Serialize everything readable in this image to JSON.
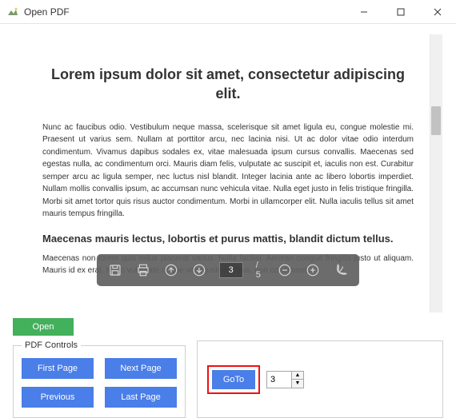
{
  "window": {
    "title": "Open PDF"
  },
  "document": {
    "heading": "Lorem ipsum dolor sit amet, consectetur adipiscing elit.",
    "para1": "Nunc ac faucibus odio. Vestibulum neque massa, scelerisque sit amet ligula eu, congue molestie mi. Praesent ut varius sem. Nullam at porttitor arcu, nec lacinia nisi. Ut ac dolor vitae odio interdum condimentum. Vivamus dapibus sodales ex, vitae malesuada ipsum cursus convallis. Maecenas sed egestas nulla, ac condimentum orci. Mauris diam felis, vulputate ac suscipit et, iaculis non est. Curabitur semper arcu ac ligula semper, nec luctus nisl blandit. Integer lacinia ante ac libero lobortis imperdiet. Nullam mollis convallis ipsum, ac accumsan nunc vehicula vitae. Nulla eget justo in felis tristique fringilla. Morbi sit amet tortor quis risus auctor condimentum. Morbi in ullamcorper elit. Nulla iaculis tellus sit amet mauris tempus fringilla.",
    "subhead": "Maecenas mauris lectus, lobortis et purus mattis, blandit dictum tellus.",
    "para2": "Maecenas non lorem quis tellus placerat varius. Nulla facilisi. Aenean congue fringilla justo ut aliquam. Mauris id ex erat. Nunc vulputate neque vitae justo facilisis, non condimentum"
  },
  "overlay": {
    "current_page": "3",
    "total_pages": "/ 5"
  },
  "buttons": {
    "open": "Open",
    "first": "First Page",
    "next": "Next Page",
    "previous": "Previous",
    "last": "Last Page",
    "goto": "GoTo"
  },
  "controls": {
    "legend": "PDF Controls",
    "goto_value": "3"
  }
}
